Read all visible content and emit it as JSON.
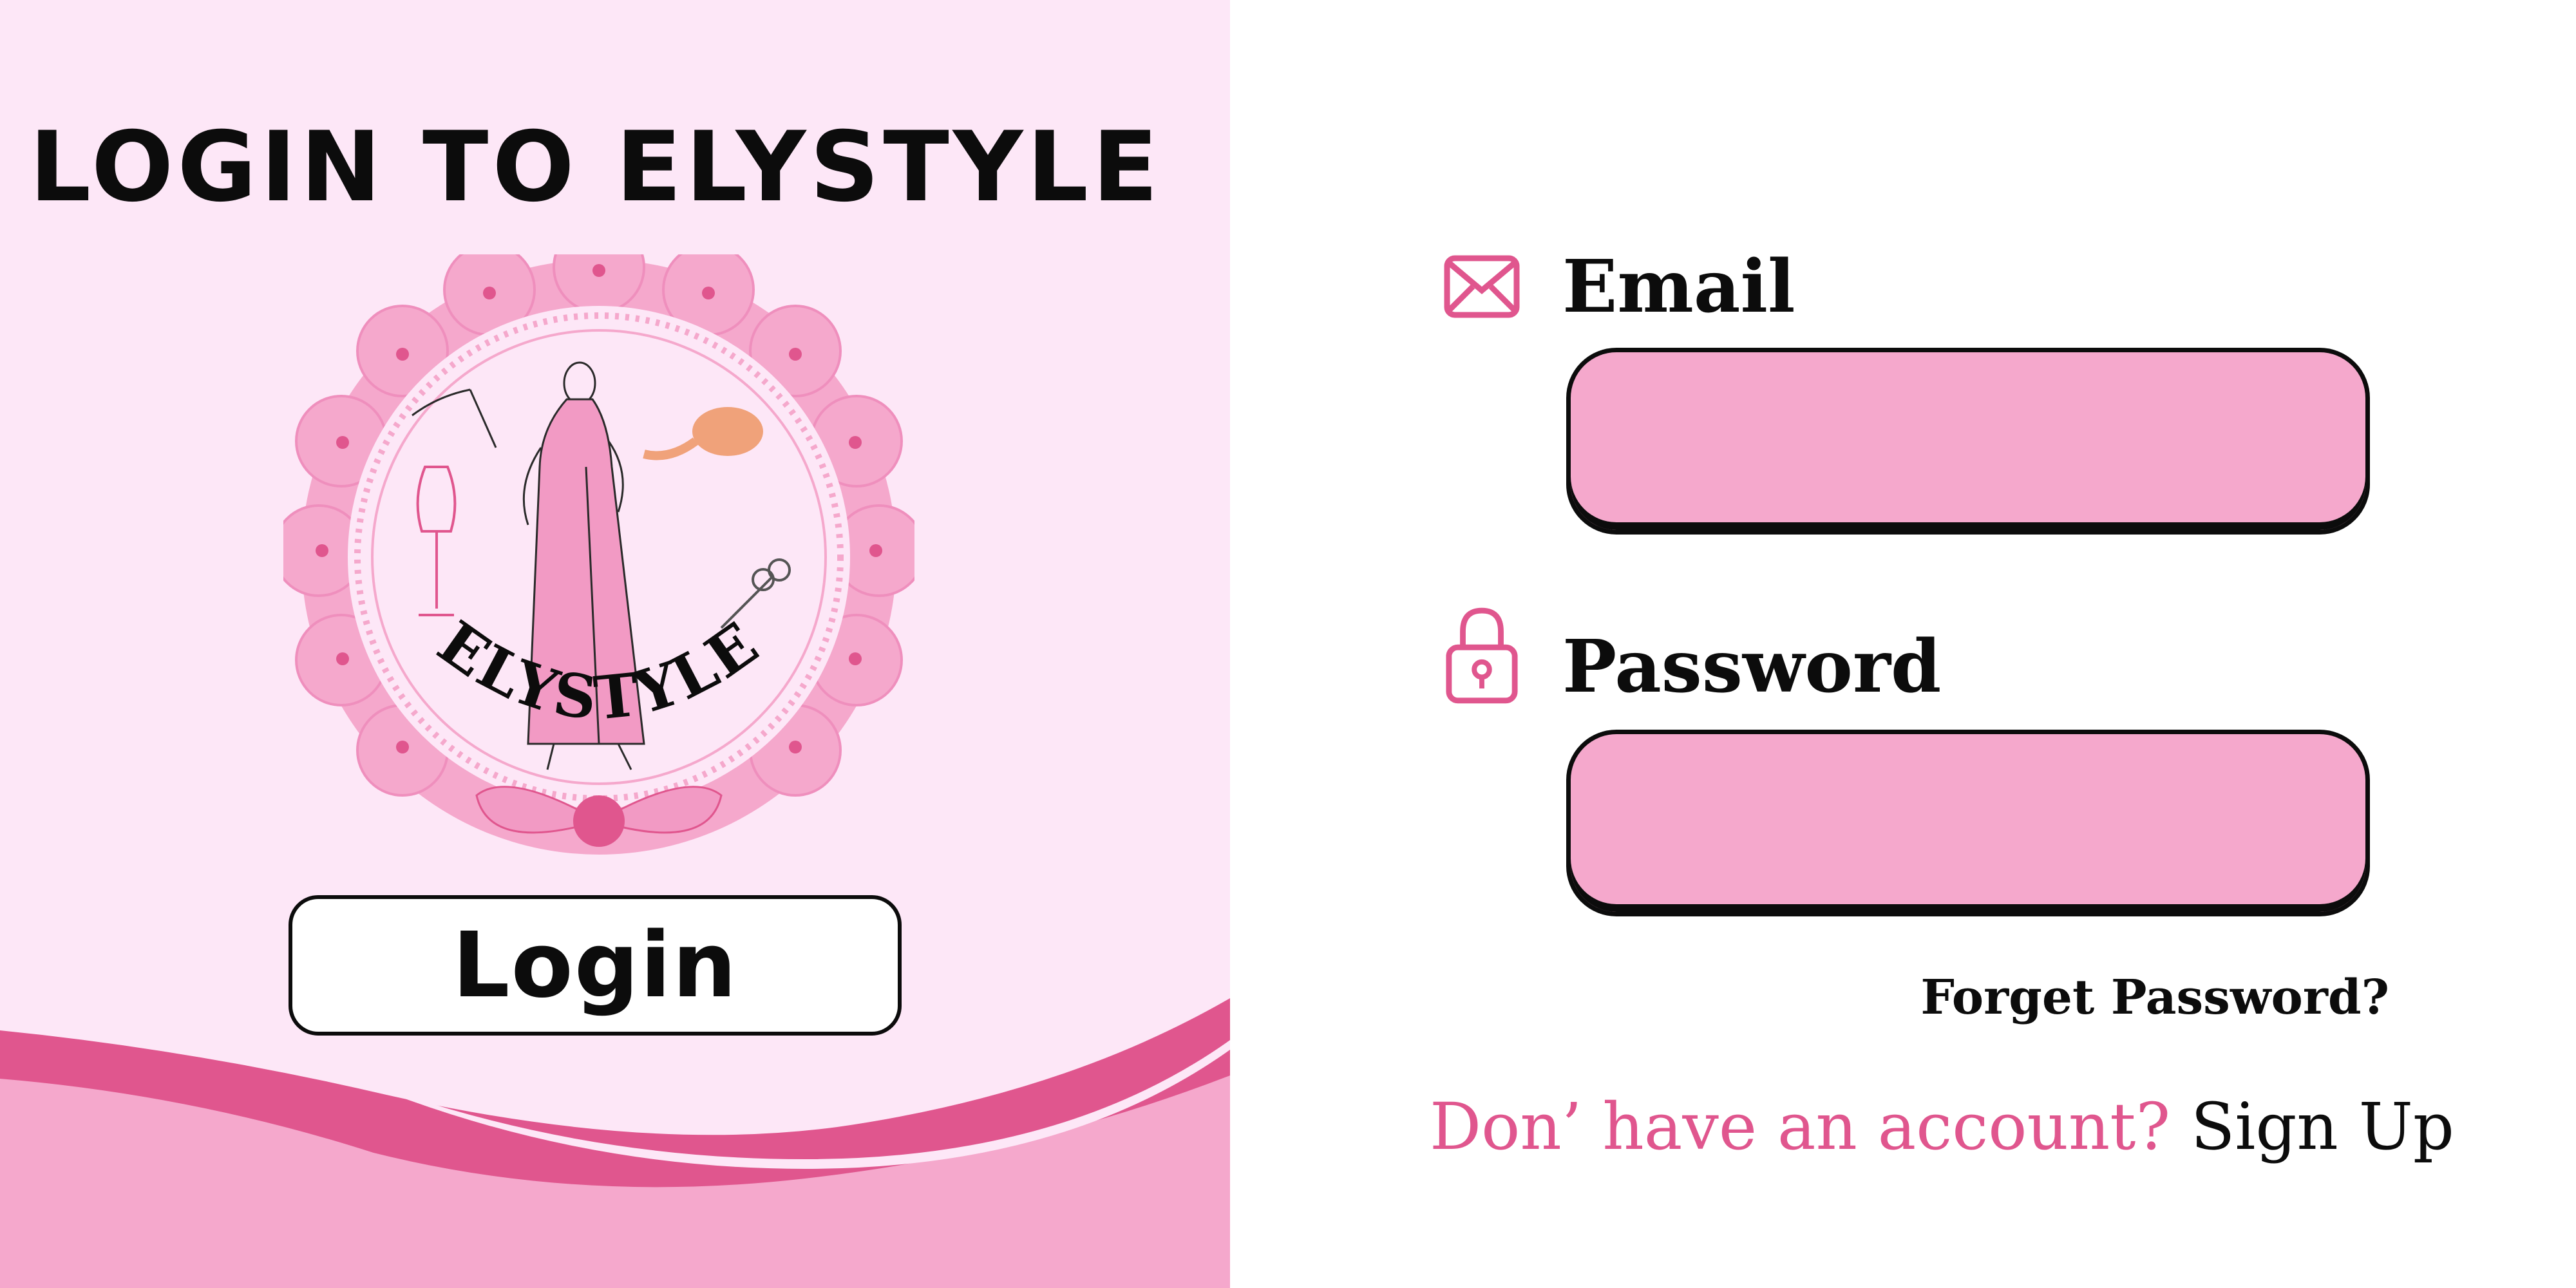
{
  "title": "LOGIN TO ELYSTYLE",
  "logo": {
    "brand_text": "ELYSTYLE"
  },
  "login_button_label": "Login",
  "email": {
    "label": "Email",
    "value": "",
    "placeholder": "",
    "icon": "envelope-icon"
  },
  "password": {
    "label": "Password",
    "value": "",
    "placeholder": "",
    "icon": "lock-icon"
  },
  "forgot_password_label": "Forget Password?",
  "signup": {
    "prompt": "Don’ have an account?",
    "link_label": "Sign Up"
  },
  "colors": {
    "left_background": "#fde7f7",
    "accent_pink": "#e0568e",
    "input_fill": "#f5a8cc",
    "text_dark": "#0c0c0c"
  }
}
